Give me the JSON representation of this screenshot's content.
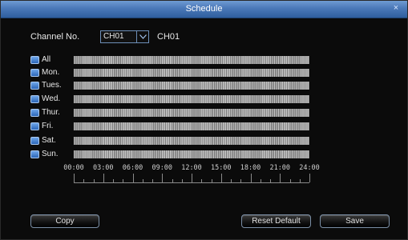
{
  "window": {
    "title": "Schedule",
    "close_glyph": "×"
  },
  "channel": {
    "label": "Channel No.",
    "selected": "CH01",
    "name": "CH01"
  },
  "days": [
    {
      "label": "All"
    },
    {
      "label": "Mon."
    },
    {
      "label": "Tues."
    },
    {
      "label": "Wed."
    },
    {
      "label": "Thur."
    },
    {
      "label": "Fri."
    },
    {
      "label": "Sat."
    },
    {
      "label": "Sun."
    }
  ],
  "timeline": [
    "00:00",
    "03:00",
    "06:00",
    "09:00",
    "12:00",
    "15:00",
    "18:00",
    "21:00",
    "24:00"
  ],
  "buttons": {
    "copy": "Copy",
    "reset_default": "Reset Default",
    "save": "Save"
  },
  "colors": {
    "title_bar": "#4a78b8",
    "checkbox": "#3f7fd0",
    "schedule_fill": "#9b9b9b"
  }
}
